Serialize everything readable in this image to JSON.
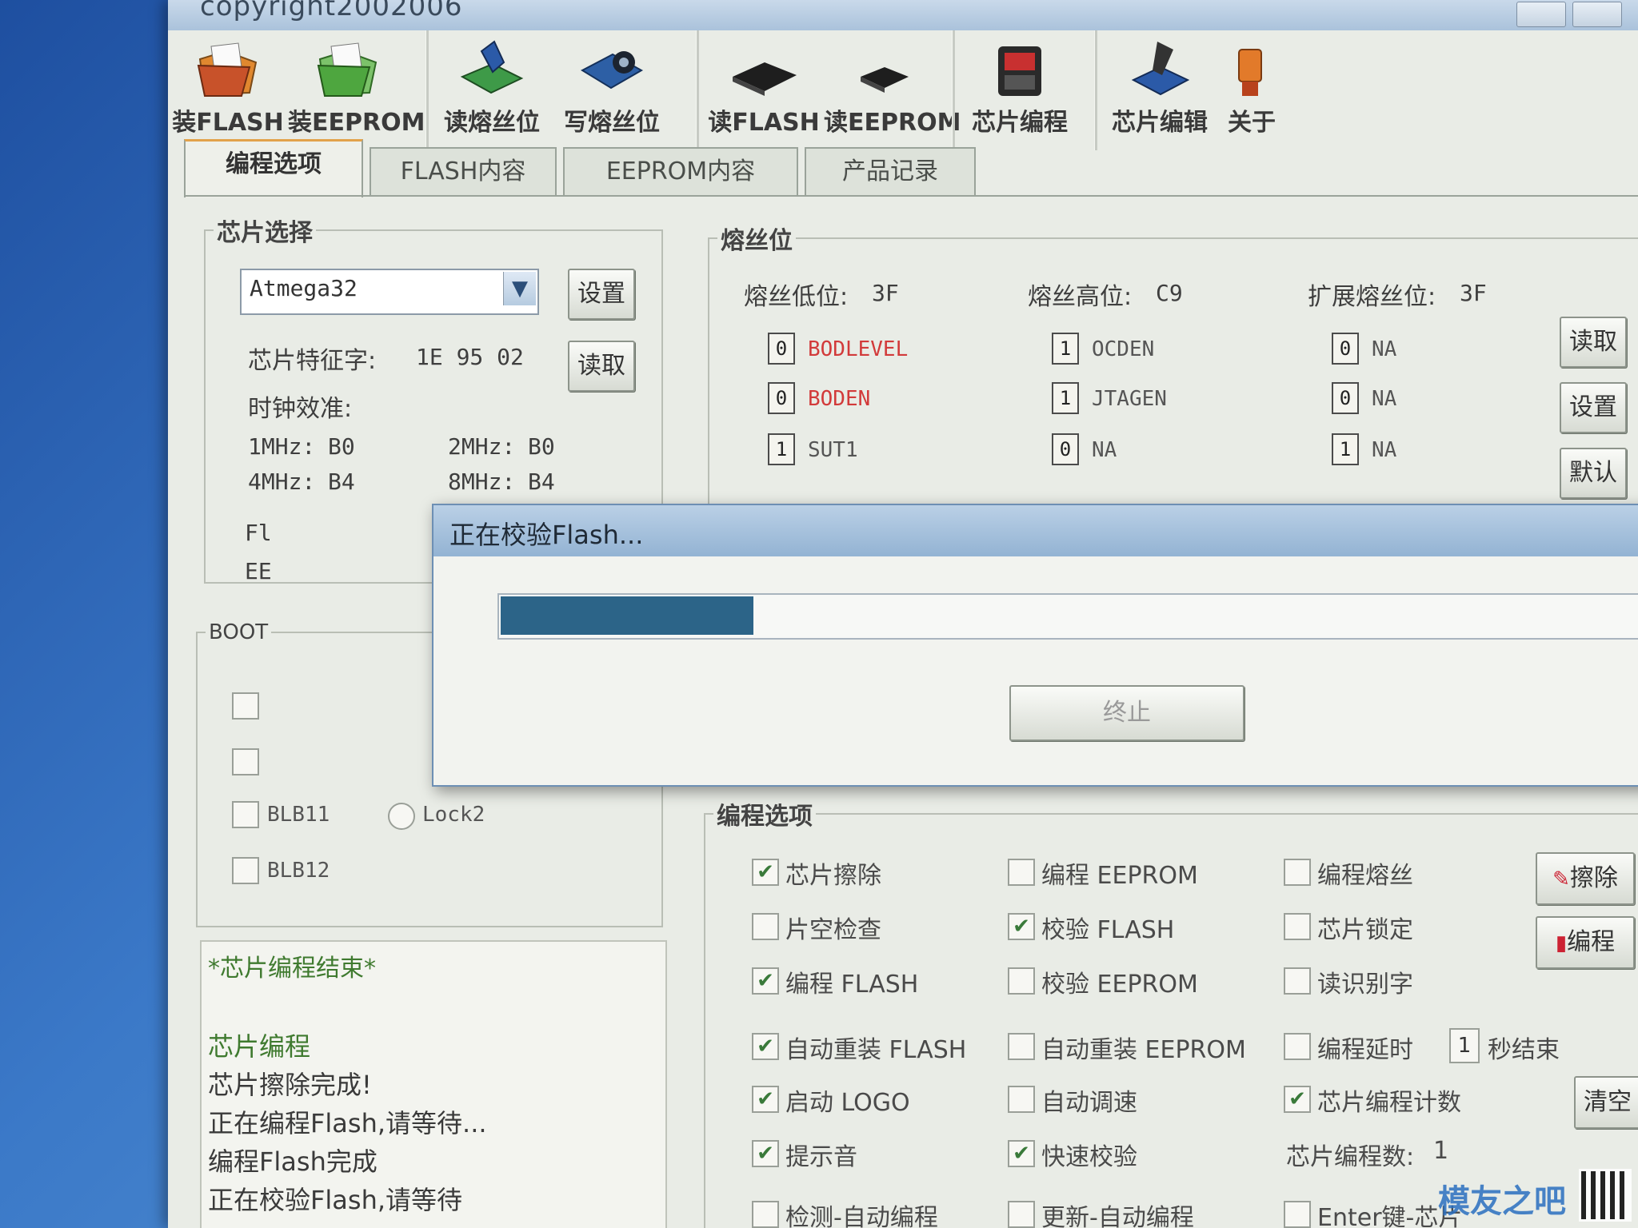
{
  "window": {
    "title": "copyright2002006"
  },
  "toolbar": {
    "buttons": [
      {
        "label": "装FLASH",
        "icon": "folder-orange-icon"
      },
      {
        "label": "装EEPROM",
        "icon": "folder-green-icon"
      },
      {
        "label": "读熔丝位",
        "icon": "chip-read-fuse-icon"
      },
      {
        "label": "写熔丝位",
        "icon": "chip-write-fuse-icon"
      },
      {
        "label": "读FLASH",
        "icon": "chip-read-flash-icon"
      },
      {
        "label": "读EEPROM",
        "icon": "chip-read-eeprom-icon"
      },
      {
        "label": "芯片编程",
        "icon": "programmer-icon"
      },
      {
        "label": "芯片编辑",
        "icon": "chip-edit-icon"
      },
      {
        "label": "关于",
        "icon": "about-icon"
      }
    ]
  },
  "tabs": [
    "编程选项",
    "FLASH内容",
    "EEPROM内容",
    "产品记录"
  ],
  "chip_select": {
    "legend": "芯片选择",
    "device": "Atmega32",
    "set_button": "设置",
    "signature_label": "芯片特征字:",
    "signature": "1E 95 02",
    "read_button": "读取",
    "calib_label": "时钟效准:",
    "calib": [
      {
        "label": "1MHz:",
        "value": "B0"
      },
      {
        "label": "2MHz:",
        "value": "B0"
      },
      {
        "label": "4MHz:",
        "value": "B4"
      },
      {
        "label": "8MHz:",
        "value": "B4"
      }
    ],
    "partial": [
      "Fl",
      "EE"
    ]
  },
  "fuse": {
    "legend": "熔丝位",
    "low_label": "熔丝低位:",
    "low": "3F",
    "high_label": "熔丝高位:",
    "high": "C9",
    "ext_label": "扩展熔丝位:",
    "ext": "3F",
    "rows": [
      [
        {
          "bit": "0",
          "name": "BODLEVEL",
          "red": true
        },
        {
          "bit": "1",
          "name": "OCDEN",
          "red": false
        },
        {
          "bit": "0",
          "name": "NA",
          "red": false
        }
      ],
      [
        {
          "bit": "0",
          "name": "BODEN",
          "red": true
        },
        {
          "bit": "1",
          "name": "JTAGEN",
          "red": false
        },
        {
          "bit": "0",
          "name": "NA",
          "red": false
        }
      ],
      [
        {
          "bit": "1",
          "name": "SUT1",
          "red": false
        },
        {
          "bit": "0",
          "name": "NA",
          "red": false
        },
        {
          "bit": "1",
          "name": "NA",
          "red": false
        }
      ]
    ],
    "buttons": [
      "读取",
      "设置",
      "默认"
    ]
  },
  "boot": {
    "legend": "BOOT",
    "items": [
      {
        "type": "check",
        "label": "BLB11"
      },
      {
        "type": "radio",
        "label": "Lock2"
      },
      {
        "type": "check",
        "label": "BLB12"
      }
    ]
  },
  "log": {
    "lines": [
      "*芯片编程结束*",
      "芯片编程",
      "芯片擦除完成!",
      "正在编程Flash,请等待...",
      "编程Flash完成",
      "正在校验Flash,请等待"
    ]
  },
  "prog_options": {
    "legend": "编程选项",
    "checks": [
      {
        "label": "芯片擦除",
        "checked": true
      },
      {
        "label": "编程 EEPROM",
        "checked": false
      },
      {
        "label": "编程熔丝",
        "checked": false
      },
      {
        "label": "片空检查",
        "checked": false
      },
      {
        "label": "校验 FLASH",
        "checked": true
      },
      {
        "label": "芯片锁定",
        "checked": false
      },
      {
        "label": "编程 FLASH",
        "checked": true
      },
      {
        "label": "校验 EEPROM",
        "checked": false
      },
      {
        "label": "读识别字",
        "checked": false
      },
      {
        "label": "自动重装 FLASH",
        "checked": true
      },
      {
        "label": "自动重装 EEPROM",
        "checked": false
      },
      {
        "label": "编程延时",
        "checked": false
      },
      {
        "label": "启动 LOGO",
        "checked": true
      },
      {
        "label": "自动调速",
        "checked": false
      },
      {
        "label": "芯片编程计数",
        "checked": true
      },
      {
        "label": "提示音",
        "checked": true
      },
      {
        "label": "快速校验",
        "checked": true
      },
      {
        "label": "检测-自动编程",
        "checked": false
      },
      {
        "label": "更新-自动编程",
        "checked": false
      },
      {
        "label": "Enter键-芯片",
        "checked": false
      }
    ],
    "delay_value": "1",
    "delay_unit": "秒结束",
    "count_label": "芯片编程数:",
    "count": "1",
    "erase_button": "擦除",
    "program_button": "编程",
    "clear_button": "清空"
  },
  "dialog": {
    "title": "正在校验Flash...",
    "progress": 0.205,
    "stop_button": "终止"
  },
  "watermark": "模友之吧"
}
